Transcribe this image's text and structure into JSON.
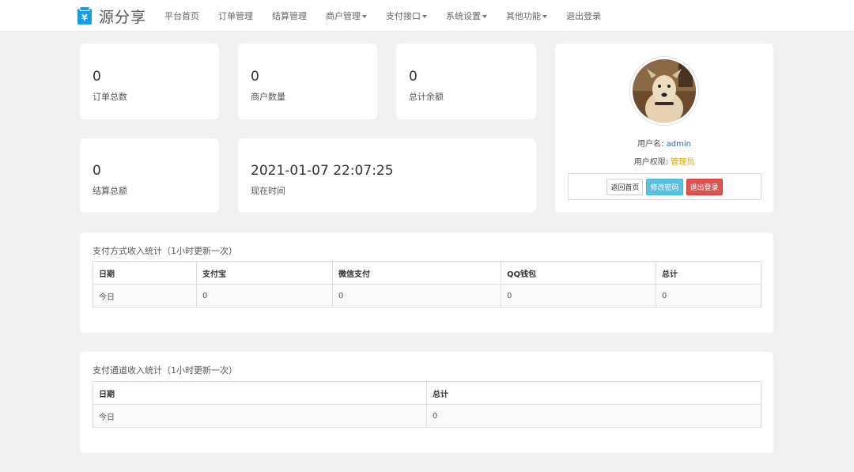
{
  "brand": {
    "name": "源分享",
    "icon": "wallet-icon",
    "accent": "#1a9be6"
  },
  "nav": [
    {
      "label": "平台首页",
      "dropdown": false
    },
    {
      "label": "订单管理",
      "dropdown": false
    },
    {
      "label": "结算管理",
      "dropdown": false
    },
    {
      "label": "商户管理",
      "dropdown": true
    },
    {
      "label": "支付接口",
      "dropdown": true
    },
    {
      "label": "系统设置",
      "dropdown": true
    },
    {
      "label": "其他功能",
      "dropdown": true
    },
    {
      "label": "退出登录",
      "dropdown": false
    }
  ],
  "stats": {
    "orders": {
      "value": "0",
      "label": "订单总数"
    },
    "merchants": {
      "value": "0",
      "label": "商户数量"
    },
    "balance": {
      "value": "0",
      "label": "总计余额"
    },
    "settlement": {
      "value": "0",
      "label": "结算总额"
    },
    "time": {
      "value": "2021-01-07 22:07:25",
      "label": "现在时间"
    }
  },
  "profile": {
    "username_label": "用户名:",
    "username": "admin",
    "role_label": "用户权限:",
    "role": "管理员",
    "buttons": {
      "home": "返回首页",
      "password": "修改密码",
      "logout": "退出登录"
    }
  },
  "payment_method_table": {
    "title": "支付方式收入统计（1小时更新一次）",
    "headers": [
      "日期",
      "支付宝",
      "微信支付",
      "QQ钱包",
      "总计"
    ],
    "rows": [
      [
        "今日",
        "0",
        "0",
        "0",
        "0"
      ]
    ]
  },
  "channel_table": {
    "title": "支付通道收入统计（1小时更新一次）",
    "headers": [
      "日期",
      "总计"
    ],
    "rows": [
      [
        "今日",
        "0"
      ]
    ]
  }
}
